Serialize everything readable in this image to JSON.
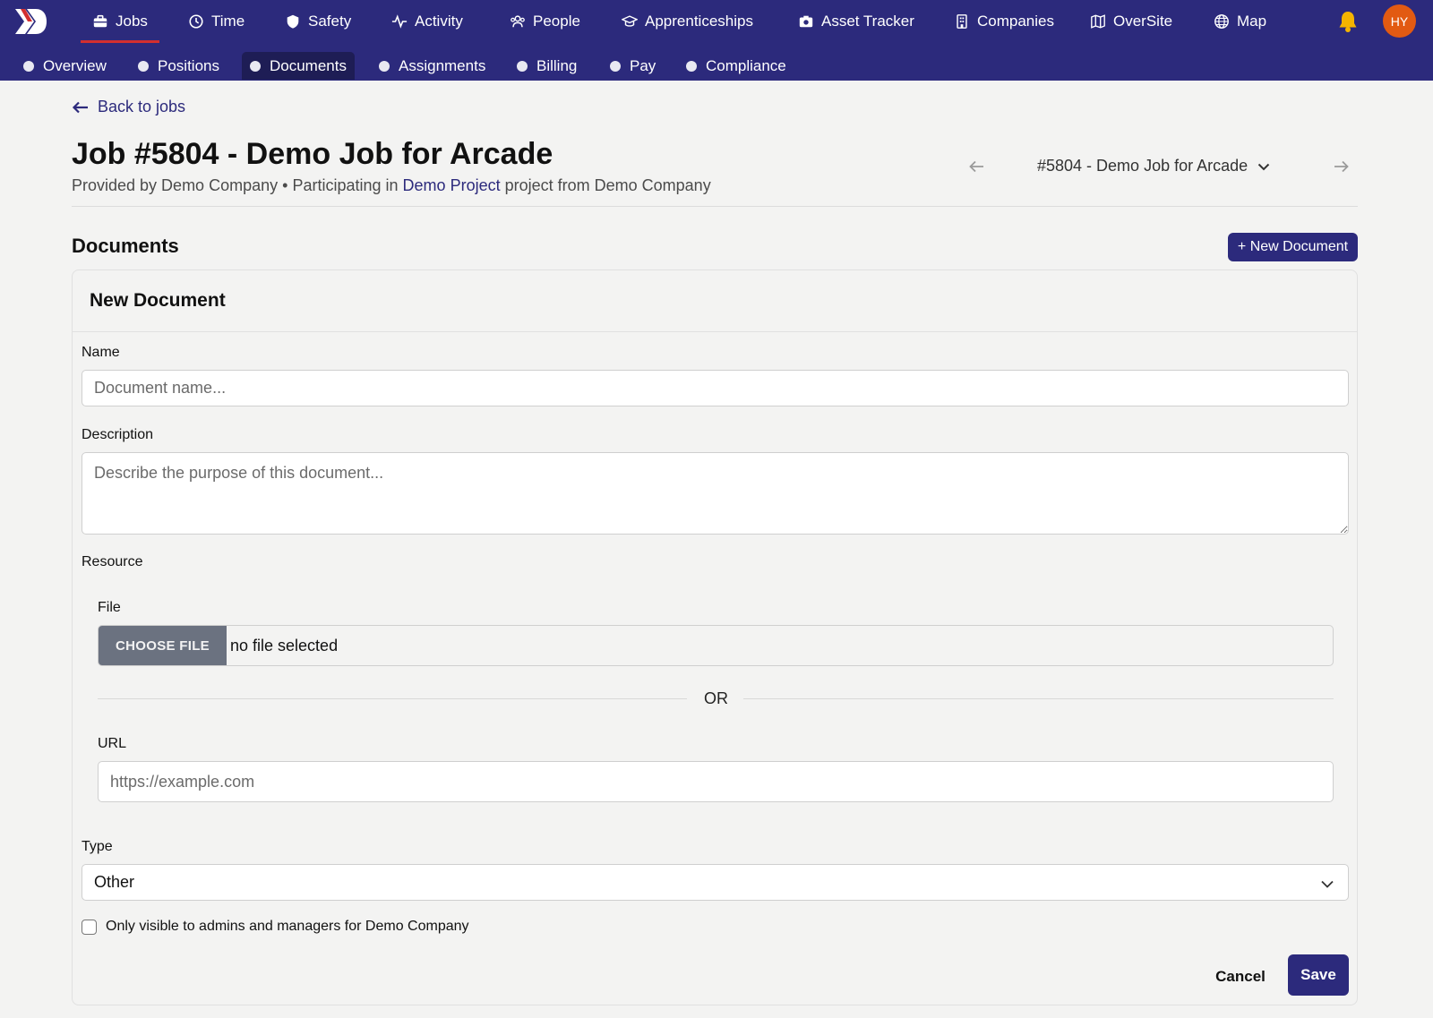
{
  "nav": {
    "items": [
      {
        "label": "Jobs",
        "icon": "briefcase-icon"
      },
      {
        "label": "Time",
        "icon": "clock-icon"
      },
      {
        "label": "Safety",
        "icon": "shield-icon"
      },
      {
        "label": "Activity",
        "icon": "activity-icon"
      },
      {
        "label": "People",
        "icon": "people-icon"
      },
      {
        "label": "Apprenticeships",
        "icon": "graduation-cap-icon"
      },
      {
        "label": "Asset Tracker",
        "icon": "camera-icon"
      },
      {
        "label": "Companies",
        "icon": "building-icon"
      },
      {
        "label": "OverSite",
        "icon": "map-fold-icon"
      },
      {
        "label": "Map",
        "icon": "globe-icon"
      }
    ],
    "active": "Jobs",
    "avatar_initials": "HY",
    "colors": {
      "bar": "#2c2a7c",
      "active_underline": "#d32f2f",
      "bell": "#f5b400",
      "avatar": "#e25a12"
    }
  },
  "subnav": {
    "items": [
      "Overview",
      "Positions",
      "Documents",
      "Assignments",
      "Billing",
      "Pay",
      "Compliance"
    ],
    "active": "Documents"
  },
  "page": {
    "back_label": "Back to jobs",
    "title": "Job #5804 - Demo Job for Arcade",
    "subtitle_provided": "Provided by Demo Company",
    "subtitle_sep": "•",
    "subtitle_participating": "Participating in",
    "subtitle_project_link": "Demo Project",
    "subtitle_from": "project from Demo Company",
    "job_selector": "#5804 - Demo Job for Arcade"
  },
  "documents": {
    "section_title": "Documents",
    "new_button": "+ New Document"
  },
  "form": {
    "card_title": "New Document",
    "name_label": "Name",
    "name_placeholder": "Document name...",
    "description_label": "Description",
    "description_placeholder": "Describe the purpose of this document...",
    "resource_label": "Resource",
    "file_label": "File",
    "file_button": "CHOOSE FILE",
    "file_status": "no file selected",
    "or_text": "OR",
    "url_label": "URL",
    "url_placeholder": "https://example.com",
    "type_label": "Type",
    "type_value": "Other",
    "visibility_label": "Only visible to admins and managers for Demo Company",
    "visibility_checked": false,
    "cancel_label": "Cancel",
    "save_label": "Save"
  }
}
